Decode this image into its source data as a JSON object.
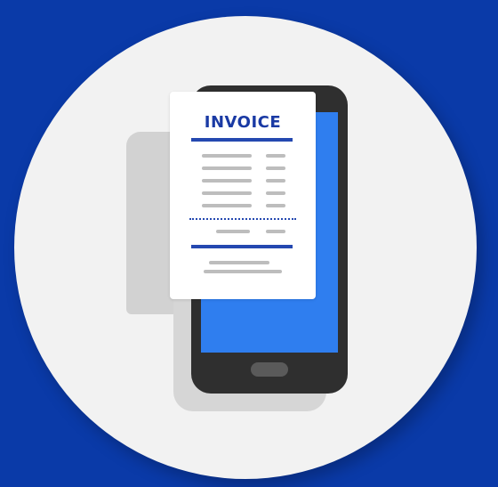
{
  "invoice": {
    "title": "INVOICE"
  },
  "colors": {
    "background": "#0a3aa8",
    "circle": "#f2f2f2",
    "phone_body": "#2f2f2f",
    "phone_screen": "#2f7eef",
    "receipt_paper": "#ffffff",
    "accent": "#1a3aa4",
    "placeholder_lines": "#bdbdbd"
  },
  "icons": {
    "main": "invoice-on-phone-illustration"
  }
}
